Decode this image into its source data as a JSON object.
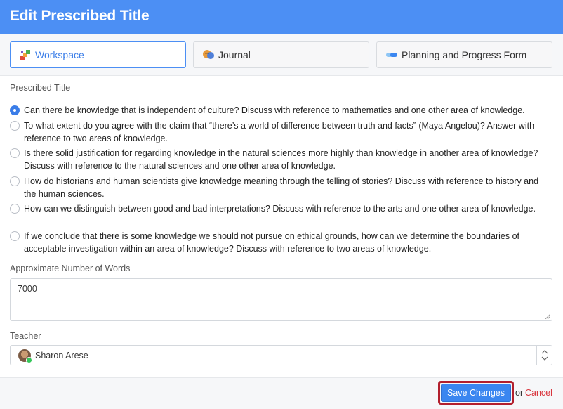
{
  "header": {
    "title": "Edit Prescribed Title"
  },
  "tabs": [
    {
      "label": "Workspace",
      "icon": "workspace-icon",
      "active": true
    },
    {
      "label": "Journal",
      "icon": "journal-icon",
      "active": false
    },
    {
      "label": "Planning and Progress Form",
      "icon": "planning-icon",
      "active": false
    }
  ],
  "prescribed_title": {
    "label": "Prescribed Title",
    "selected_index": 0,
    "options": [
      "Can there be knowledge that is independent of culture? Discuss with reference to mathematics and one other area of knowledge.",
      "To what extent do you agree with the claim that “there’s a world of difference between truth and facts” (Maya Angelou)? Answer with reference to two areas of knowledge.",
      "Is there solid justification for regarding knowledge in the natural sciences more highly than knowledge in another area of knowledge? Discuss with reference to the natural sciences and one other area of knowledge.",
      "How do historians and human scientists give knowledge meaning through the telling of stories? Discuss with reference to history and the human sciences.",
      "How can we distinguish between good and bad interpretations? Discuss with reference to the arts and one other area of knowledge.",
      "If we conclude that there is some knowledge we should not pursue on ethical grounds, how can we determine the boundaries of acceptable investigation within an area of knowledge? Discuss with reference to two areas of knowledge."
    ]
  },
  "words": {
    "label": "Approximate Number of Words",
    "value": "7000"
  },
  "teacher": {
    "label": "Teacher",
    "value": "Sharon Arese"
  },
  "footer": {
    "save_label": "Save Changes",
    "or_label": "or",
    "cancel_label": "Cancel"
  },
  "colors": {
    "header": "#4c8ff4",
    "accent": "#3a86f0",
    "cancel": "#d9363e",
    "highlight": "#b21f2d"
  }
}
